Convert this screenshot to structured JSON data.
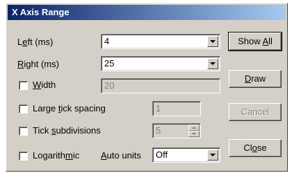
{
  "window": {
    "title": "X Axis Range"
  },
  "left": {
    "label": "Left (ms)",
    "value": "4"
  },
  "right": {
    "label": "Right (ms)",
    "value": "25"
  },
  "width": {
    "label": "Width",
    "value": "20",
    "checked": false
  },
  "large_tick": {
    "label": "Large tick spacing",
    "value": "1",
    "checked": false
  },
  "tick_subdiv": {
    "label": "Tick subdivisions",
    "value": "5",
    "checked": false
  },
  "logarithmic": {
    "label": "Logarithmic",
    "checked": false
  },
  "auto_units": {
    "label": "Auto units",
    "value": "Off"
  },
  "buttons": {
    "show_all": "Show All",
    "draw": "Draw",
    "cancel": "Cancel",
    "close": "Close"
  }
}
